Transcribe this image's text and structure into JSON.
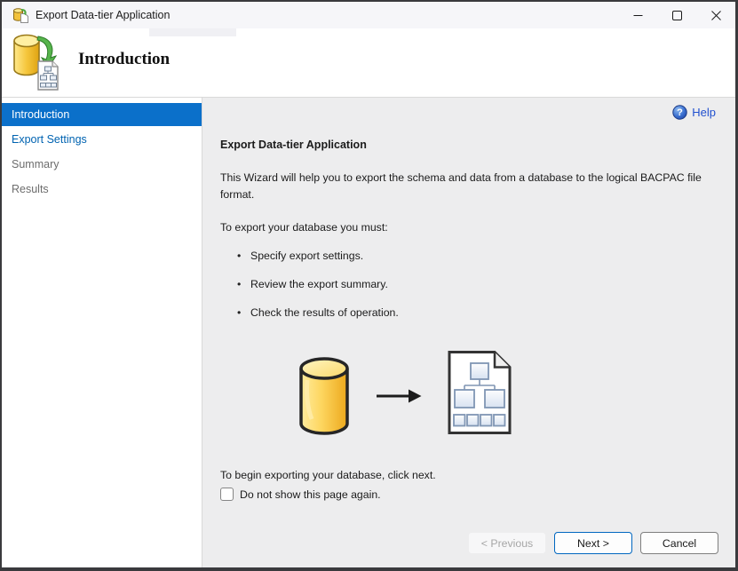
{
  "window": {
    "title": "Export Data-tier Application"
  },
  "header": {
    "title": "Introduction"
  },
  "sidebar": {
    "items": [
      {
        "label": "Introduction",
        "state": "selected"
      },
      {
        "label": "Export Settings",
        "state": "link"
      },
      {
        "label": "Summary",
        "state": "dim"
      },
      {
        "label": "Results",
        "state": "dim"
      }
    ]
  },
  "content": {
    "help_label": "Help",
    "heading": "Export Data-tier Application",
    "intro": "This Wizard will help you to export the schema and data from a database to the logical BACPAC file format.",
    "steps_intro": "To export your database you must:",
    "steps": [
      "Specify export settings.",
      "Review the export summary.",
      "Check the results of operation."
    ],
    "note": "To begin exporting your database, click next.",
    "checkbox_label": "Do not show this page again.",
    "checkbox_checked": false
  },
  "buttons": {
    "previous": "< Previous",
    "next": "Next >",
    "cancel": "Cancel"
  },
  "icons": {
    "app_icon": "database-export-icon",
    "help_glyph": "?",
    "bullet": "•"
  },
  "colors": {
    "selected_blue": "#0b70ca",
    "sidebar_link_blue": "#0063b1",
    "help_blue": "#2050cf",
    "next_border_blue": "#0067c0",
    "pane_gray": "#ededee",
    "cylinder_yellow": "#fdd55e"
  }
}
